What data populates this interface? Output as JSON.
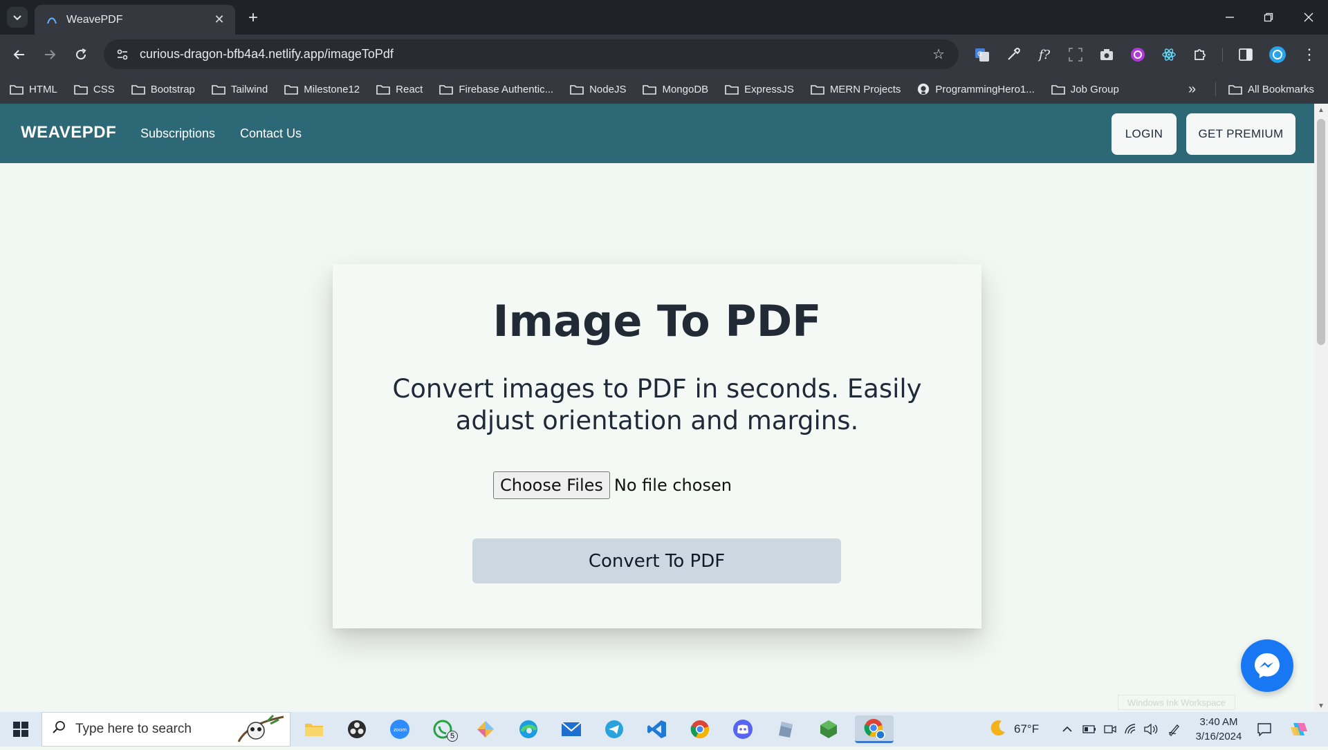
{
  "browser": {
    "tab_title": "WeavePDF",
    "url": "curious-dragon-bfb4a4.netlify.app/imageToPdf",
    "bookmarks": [
      "HTML",
      "CSS",
      "Bootstrap",
      "Tailwind",
      "Milestone12",
      "React",
      "Firebase Authentic...",
      "NodeJS",
      "MongoDB",
      "ExpressJS",
      "MERN Projects",
      "ProgrammingHero1...",
      "Job Group"
    ],
    "all_bookmarks": "All Bookmarks",
    "more_glyph": "»"
  },
  "nav": {
    "brand": "WEAVEPDF",
    "links": [
      "Subscriptions",
      "Contact Us"
    ],
    "login": "LOGIN",
    "premium": "GET PREMIUM"
  },
  "card": {
    "title": "Image To PDF",
    "subtitle": "Convert images to PDF in seconds. Easily adjust orientation and margins.",
    "choose_files": "Choose Files",
    "file_status": "No file chosen",
    "convert": "Convert To PDF"
  },
  "watermark": "Windows Ink Workspace",
  "taskbar": {
    "search_placeholder": "Type here to search",
    "whatsapp_badge": "5",
    "weather": "67°F",
    "time": "3:40 AM",
    "date": "3/16/2024"
  },
  "colors": {
    "navbar": "#2d6877",
    "page_bg": "#f1f7f2",
    "convert_button": "#cbd8e1",
    "messenger": "#1877f2"
  }
}
